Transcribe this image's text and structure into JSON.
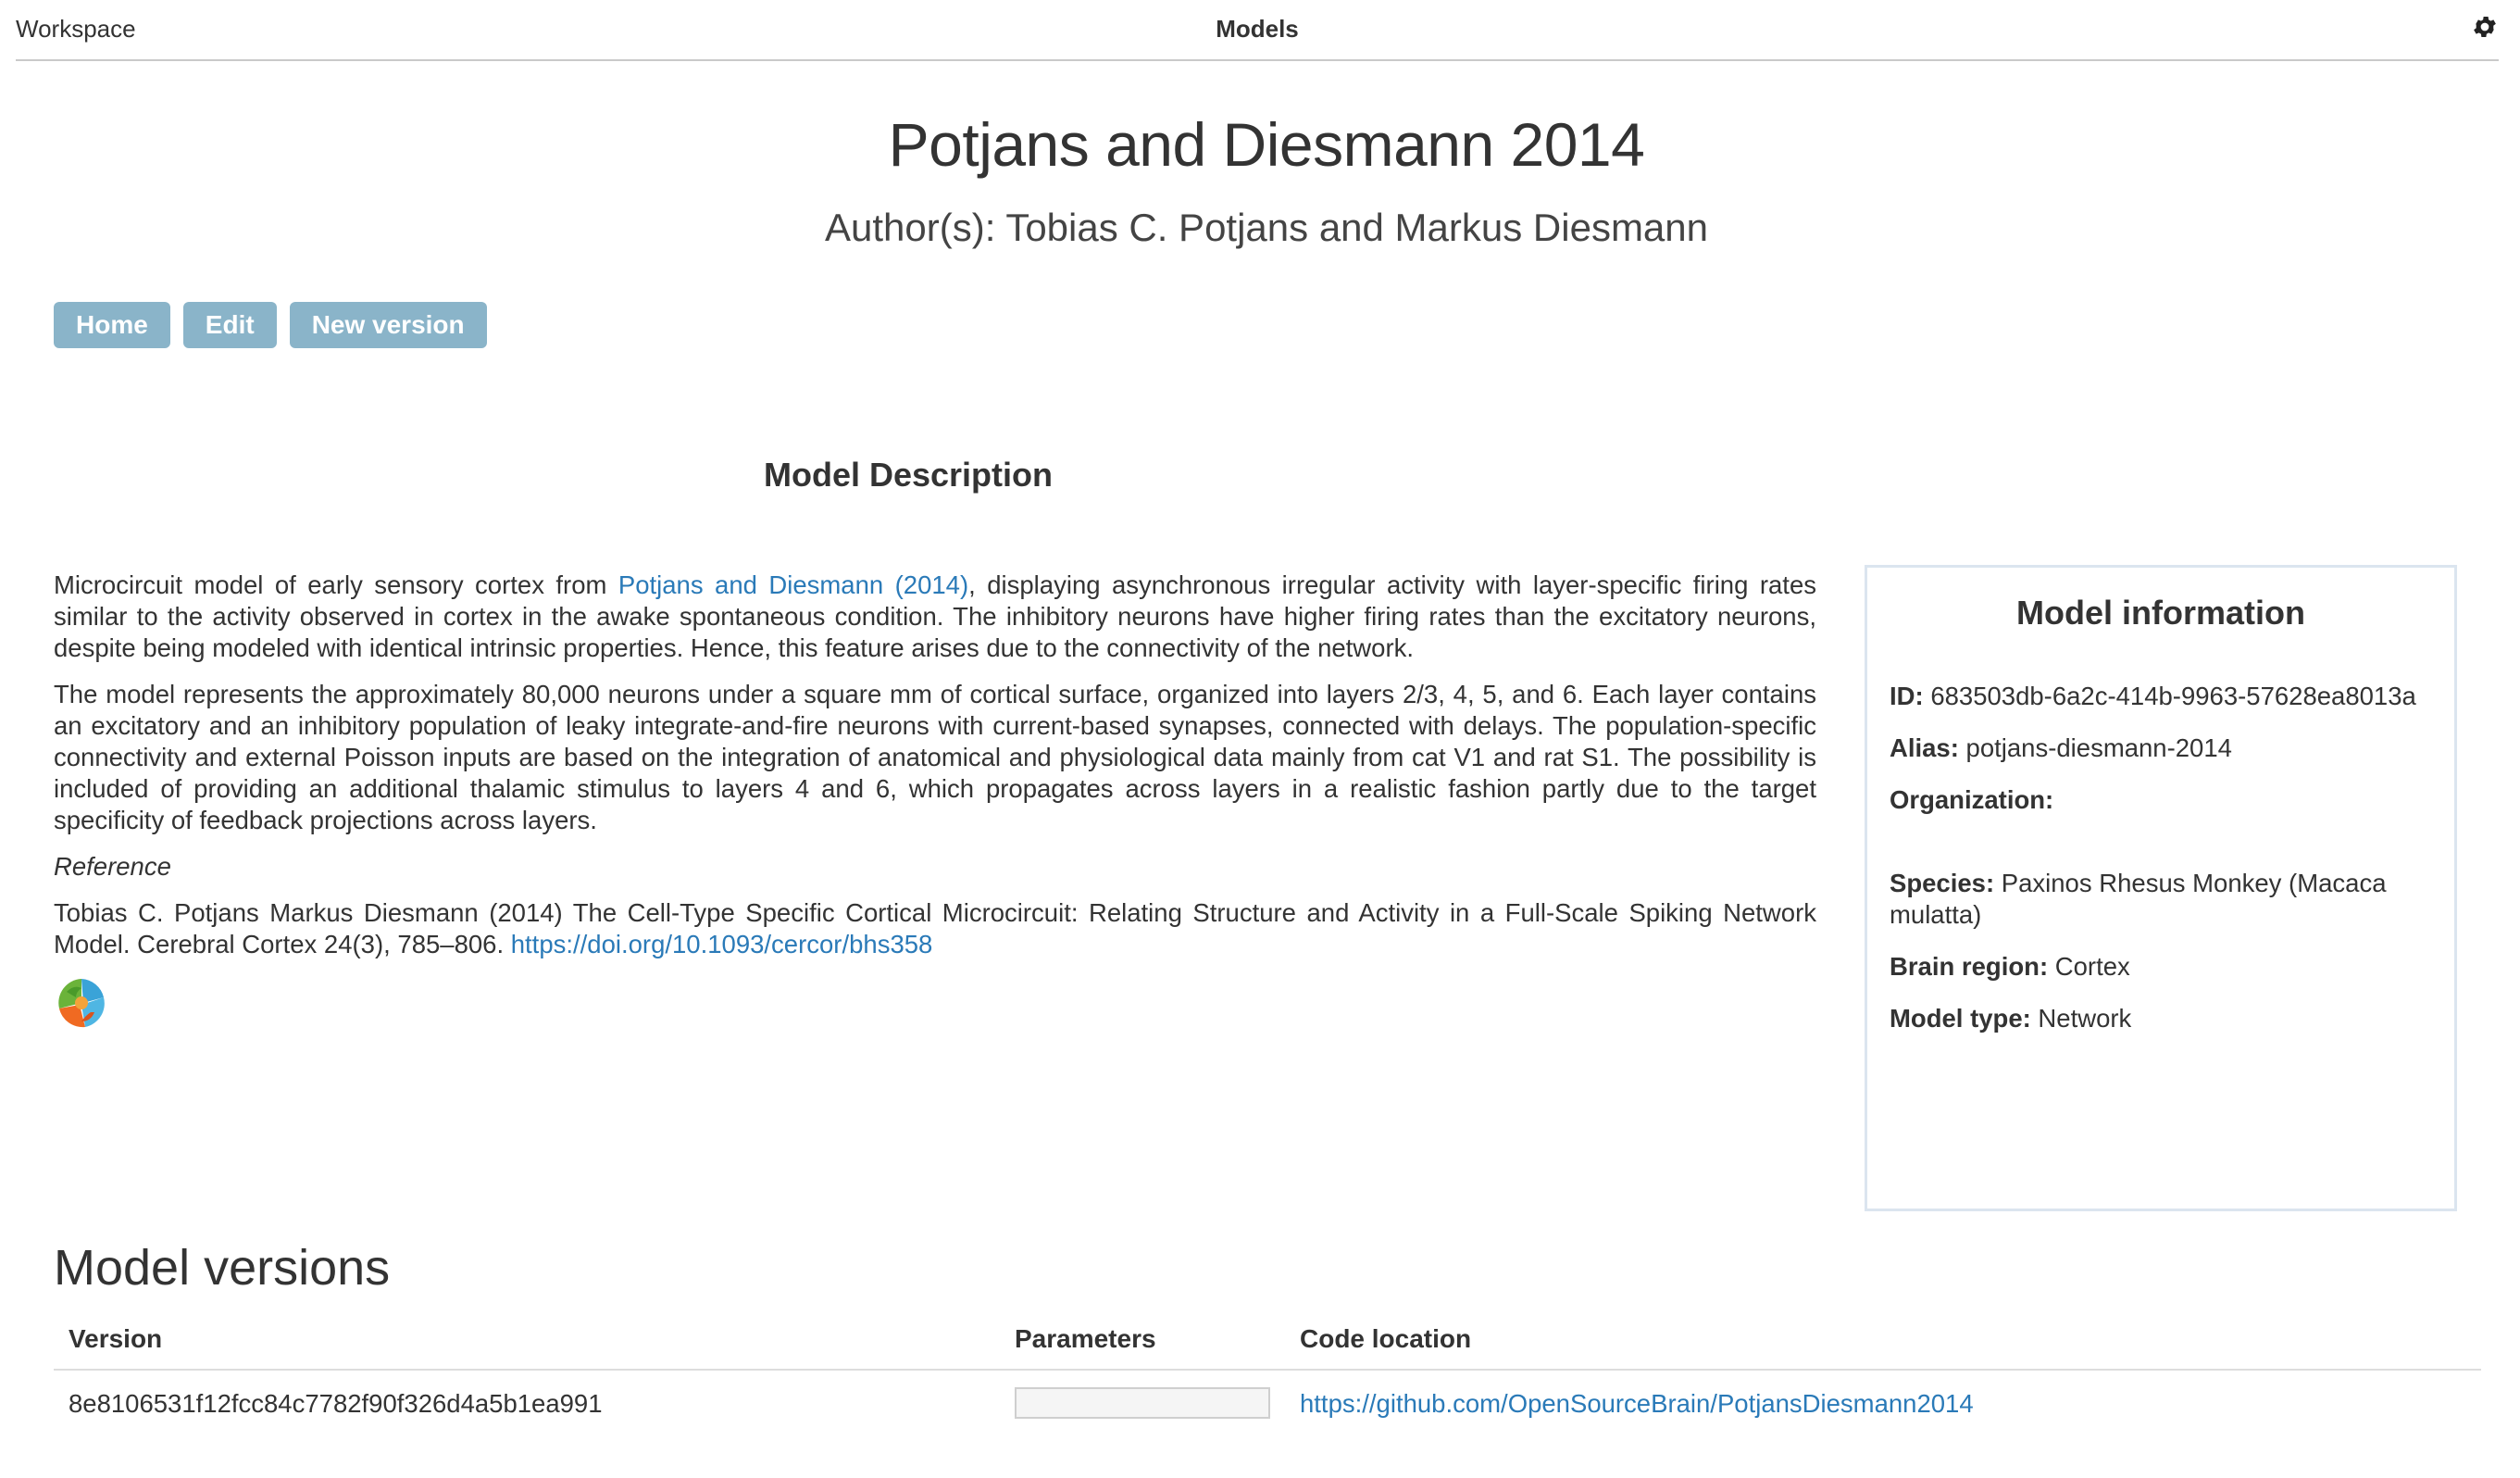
{
  "topbar": {
    "workspace": "Workspace",
    "title": "Models",
    "settings_icon": "gear-icon"
  },
  "model": {
    "title": "Potjans and Diesmann 2014",
    "authors_label": "Author(s):",
    "authors": "Tobias C. Potjans and Markus Diesmann"
  },
  "actions": {
    "home": "Home",
    "edit": "Edit",
    "new_version": "New version"
  },
  "description": {
    "heading": "Model Description",
    "p1_before": "Microcircuit model of early sensory cortex from ",
    "p1_link": "Potjans and Diesmann (2014)",
    "p1_after": ", displaying asynchronous irregular activity with layer-specific firing rates similar to the activity observed in cortex in the awake spontaneous condition. The inhibitory neurons have higher firing rates than the excitatory neurons, despite being modeled with identical intrinsic properties. Hence, this feature arises due to the connectivity of the network.",
    "p2": "The model represents the approximately 80,000 neurons under a square mm of cortical surface, organized into layers 2/3, 4, 5, and 6. Each layer contains an excitatory and an inhibitory population of leaky integrate-and-fire neurons with current-based synapses, connected with delays. The population-specific connectivity and external Poisson inputs are based on the integration of anatomical and physiological data mainly from cat V1 and rat S1. The possibility is included of providing an additional thalamic stimulus to layers 4 and 6, which propagates across layers in a realistic fashion partly due to the target specificity of feedback projections across layers.",
    "reference_label": "Reference",
    "reference_text": "Tobias C. Potjans Markus Diesmann (2014) The Cell-Type Specific Cortical Microcircuit: Relating Structure and Activity in a Full-Scale Spiking Network Model. Cerebral Cortex 24(3), 785–806. ",
    "reference_link": "https://doi.org/10.1093/cercor/bhs358",
    "logo_icon": "open-source-brain-logo"
  },
  "info": {
    "title": "Model information",
    "id_label": "ID:",
    "id": "683503db-6a2c-414b-9963-57628ea8013a",
    "alias_label": "Alias:",
    "alias": "potjans-diesmann-2014",
    "organization_label": "Organization:",
    "organization": "",
    "species_label": "Species:",
    "species": "Paxinos Rhesus Monkey (Macaca mulatta)",
    "brain_region_label": "Brain region:",
    "brain_region": "Cortex",
    "model_type_label": "Model type:",
    "model_type": "Network"
  },
  "versions": {
    "heading": "Model versions",
    "columns": [
      "Version",
      "Parameters",
      "Code location"
    ],
    "rows": [
      {
        "version": "8e8106531f12fcc84c7782f90f326d4a5b1ea991",
        "parameters": "",
        "code_location": "https://github.com/OpenSourceBrain/PotjansDiesmann2014"
      }
    ]
  },
  "colors": {
    "button_bg": "#8ab4c9",
    "link": "#2a7ab8",
    "panel_border": "#dbe5ef"
  }
}
